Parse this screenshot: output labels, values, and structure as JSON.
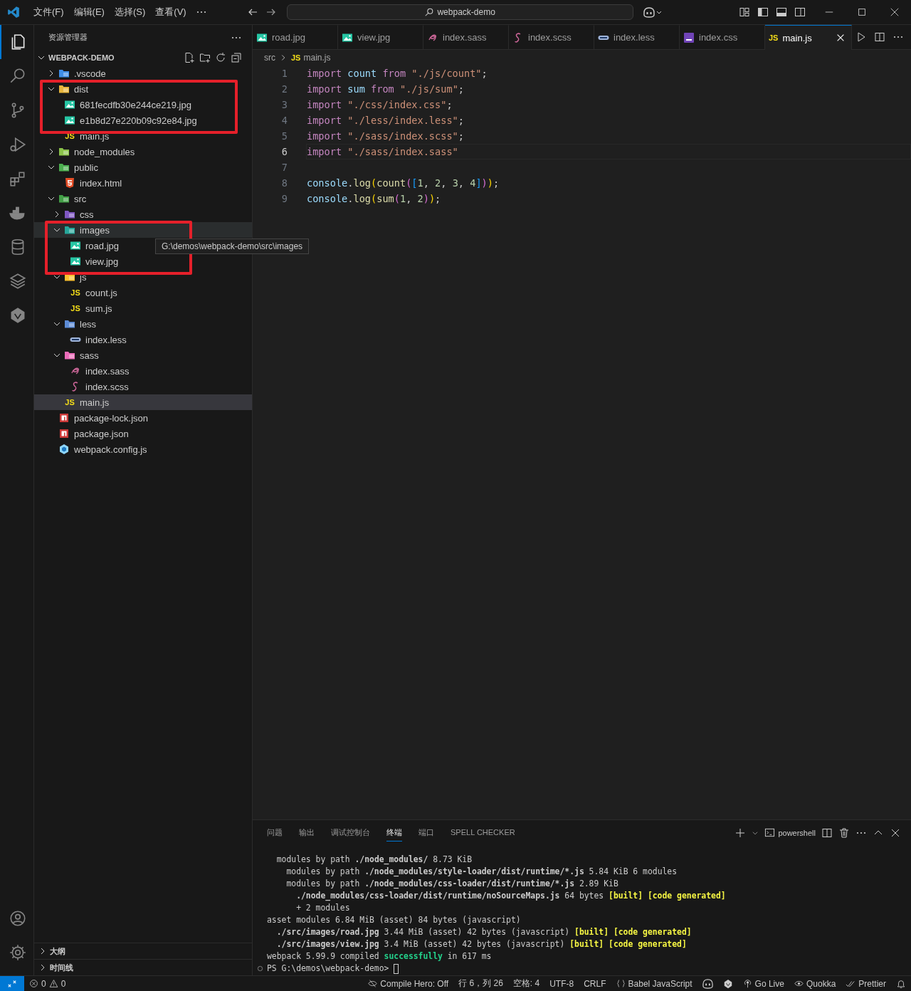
{
  "title_bar": {
    "menus": [
      "文件(F)",
      "编辑(E)",
      "选择(S)",
      "查看(V)"
    ],
    "search": {
      "value": "webpack-demo"
    }
  },
  "activity_bar": {
    "items": [
      {
        "kind": "explorer",
        "selected": true
      },
      {
        "kind": "search",
        "selected": false
      },
      {
        "kind": "source-control",
        "selected": false
      },
      {
        "kind": "run",
        "selected": false
      },
      {
        "kind": "extensions",
        "selected": false
      },
      {
        "kind": "docker",
        "selected": false
      },
      {
        "kind": "database",
        "selected": false
      },
      {
        "kind": "layers",
        "selected": false
      },
      {
        "kind": "plugin",
        "selected": false
      }
    ],
    "bottom": [
      {
        "kind": "account"
      },
      {
        "kind": "settings"
      }
    ]
  },
  "sidebar": {
    "title": "资源管理器",
    "project": "WEBPACK-DEMO",
    "tree": [
      {
        "label": ".vscode",
        "kind": "folder",
        "color": "#3f8ee8",
        "expanded": false,
        "selected": false,
        "annotated": false
      },
      {
        "label": "dist",
        "kind": "folder",
        "color": "#e8b53c",
        "expanded": true,
        "selected": false,
        "annotated": true,
        "children": [
          {
            "label": "681fecdfb30e244ce219.jpg",
            "kind": "image",
            "selected": false,
            "annotated": true
          },
          {
            "label": "e1b8d27e220b09c92e84.jpg",
            "kind": "image",
            "selected": false,
            "annotated": true
          },
          {
            "label": "main.js",
            "kind": "js",
            "icon_text": "JS",
            "selected": false,
            "annotated": false
          }
        ]
      },
      {
        "label": "node_modules",
        "kind": "folder",
        "color": "#8bc34a",
        "expanded": false,
        "selected": false,
        "annotated": false
      },
      {
        "label": "public",
        "kind": "folder",
        "color": "#4caf50",
        "expanded": true,
        "selected": false,
        "annotated": false,
        "children": [
          {
            "label": "index.html",
            "kind": "html",
            "selected": false,
            "annotated": false
          }
        ]
      },
      {
        "label": "src",
        "kind": "folder",
        "color": "#43a047",
        "expanded": true,
        "selected": false,
        "annotated": false,
        "children": [
          {
            "label": "css",
            "kind": "folder",
            "color": "#7e57c2",
            "expanded": false,
            "selected": false,
            "annotated": false
          },
          {
            "label": "images",
            "kind": "folder",
            "color": "#26a69a",
            "expanded": true,
            "selected": false,
            "annotated": true,
            "tooltip": "G:\\demos\\webpack-demo\\src\\images",
            "children": [
              {
                "label": "road.jpg",
                "kind": "image",
                "selected": false,
                "annotated": true
              },
              {
                "label": "view.jpg",
                "kind": "image",
                "selected": false,
                "annotated": true
              }
            ]
          },
          {
            "label": "js",
            "kind": "folder",
            "color": "#fbc02d",
            "expanded": true,
            "selected": false,
            "annotated": false,
            "children": [
              {
                "label": "count.js",
                "kind": "js",
                "icon_text": "JS",
                "selected": false,
                "annotated": false
              },
              {
                "label": "sum.js",
                "kind": "js",
                "icon_text": "JS",
                "selected": false,
                "annotated": false
              }
            ]
          },
          {
            "label": "less",
            "kind": "folder",
            "color": "#5c8bd6",
            "expanded": true,
            "selected": false,
            "annotated": false,
            "children": [
              {
                "label": "index.less",
                "kind": "less",
                "selected": false,
                "annotated": false
              }
            ]
          },
          {
            "label": "sass",
            "kind": "folder",
            "color": "#ec6cb9",
            "expanded": true,
            "selected": false,
            "annotated": false,
            "children": [
              {
                "label": "index.sass",
                "kind": "sass",
                "selected": false,
                "annotated": false
              },
              {
                "label": "index.scss",
                "kind": "scss",
                "selected": false,
                "annotated": false
              }
            ]
          },
          {
            "label": "main.js",
            "kind": "js",
            "icon_text": "JS",
            "selected": true,
            "annotated": false
          }
        ]
      },
      {
        "label": "package-lock.json",
        "kind": "npm",
        "selected": false,
        "annotated": false
      },
      {
        "label": "package.json",
        "kind": "npm",
        "selected": false,
        "annotated": false
      },
      {
        "label": "webpack.config.js",
        "kind": "webpack",
        "selected": false,
        "annotated": false
      }
    ],
    "sections": [
      {
        "label": "大纲",
        "expanded": false
      },
      {
        "label": "时间线",
        "expanded": false
      }
    ]
  },
  "tabs": [
    {
      "label": "road.jpg",
      "kind": "image",
      "selected": false
    },
    {
      "label": "view.jpg",
      "kind": "image",
      "selected": false
    },
    {
      "label": "index.sass",
      "kind": "sass",
      "selected": false
    },
    {
      "label": "index.scss",
      "kind": "scss",
      "selected": false
    },
    {
      "label": "index.less",
      "kind": "less",
      "selected": false
    },
    {
      "label": "index.css",
      "kind": "css",
      "selected": false
    },
    {
      "label": "main.js",
      "kind": "js",
      "icon_text": "JS",
      "selected": true
    }
  ],
  "breadcrumb": {
    "folder": "src",
    "icon_text": "JS",
    "file": "main.js"
  },
  "code": [
    {
      "number": "1",
      "current": false,
      "tokens": [
        {
          "kind": "kw",
          "text": "import "
        },
        {
          "kind": "var",
          "text": "count "
        },
        {
          "kind": "kw",
          "text": "from "
        },
        {
          "kind": "str",
          "text": "\"./js/count\""
        },
        {
          "kind": "punc",
          "text": ";"
        }
      ]
    },
    {
      "number": "2",
      "current": false,
      "tokens": [
        {
          "kind": "kw",
          "text": "import "
        },
        {
          "kind": "var",
          "text": "sum "
        },
        {
          "kind": "kw",
          "text": "from "
        },
        {
          "kind": "str",
          "text": "\"./js/sum\""
        },
        {
          "kind": "punc",
          "text": ";"
        }
      ]
    },
    {
      "number": "3",
      "current": false,
      "tokens": [
        {
          "kind": "kw",
          "text": "import "
        },
        {
          "kind": "str",
          "text": "\"./css/index.css\""
        },
        {
          "kind": "punc",
          "text": ";"
        }
      ]
    },
    {
      "number": "4",
      "current": false,
      "tokens": [
        {
          "kind": "kw",
          "text": "import "
        },
        {
          "kind": "str",
          "text": "\"./less/index.less\""
        },
        {
          "kind": "punc",
          "text": ";"
        }
      ]
    },
    {
      "number": "5",
      "current": false,
      "tokens": [
        {
          "kind": "kw",
          "text": "import "
        },
        {
          "kind": "str",
          "text": "\"./sass/index.scss\""
        },
        {
          "kind": "punc",
          "text": ";"
        }
      ]
    },
    {
      "number": "6",
      "current": true,
      "tokens": [
        {
          "kind": "kw",
          "text": "import "
        },
        {
          "kind": "str",
          "text": "\"./sass/index.sass\""
        }
      ]
    },
    {
      "number": "7",
      "current": false
    },
    {
      "number": "8",
      "current": false,
      "tokens": [
        {
          "kind": "var",
          "text": "console"
        },
        {
          "kind": "punc",
          "text": "."
        },
        {
          "kind": "fn",
          "text": "log"
        },
        {
          "kind": "b1",
          "text": "("
        },
        {
          "kind": "fn",
          "text": "count"
        },
        {
          "kind": "b2",
          "text": "("
        },
        {
          "kind": "b3",
          "text": "["
        },
        {
          "kind": "num",
          "text": "1"
        },
        {
          "kind": "punc",
          "text": ", "
        },
        {
          "kind": "num",
          "text": "2"
        },
        {
          "kind": "punc",
          "text": ", "
        },
        {
          "kind": "num",
          "text": "3"
        },
        {
          "kind": "punc",
          "text": ", "
        },
        {
          "kind": "num",
          "text": "4"
        },
        {
          "kind": "b3",
          "text": "]"
        },
        {
          "kind": "b2",
          "text": ")"
        },
        {
          "kind": "b1",
          "text": ")"
        },
        {
          "kind": "punc",
          "text": ";"
        }
      ]
    },
    {
      "number": "9",
      "current": false,
      "tokens": [
        {
          "kind": "var",
          "text": "console"
        },
        {
          "kind": "punc",
          "text": "."
        },
        {
          "kind": "fn",
          "text": "log"
        },
        {
          "kind": "b1",
          "text": "("
        },
        {
          "kind": "fn",
          "text": "sum"
        },
        {
          "kind": "b2",
          "text": "("
        },
        {
          "kind": "num",
          "text": "1"
        },
        {
          "kind": "punc",
          "text": ", "
        },
        {
          "kind": "num",
          "text": "2"
        },
        {
          "kind": "b2",
          "text": ")"
        },
        {
          "kind": "b1",
          "text": ")"
        },
        {
          "kind": "punc",
          "text": ";"
        }
      ]
    }
  ],
  "panel": {
    "tabs": [
      {
        "label": "问题",
        "selected": false
      },
      {
        "label": "输出",
        "selected": false
      },
      {
        "label": "调试控制台",
        "selected": false
      },
      {
        "label": "终端",
        "selected": true
      },
      {
        "label": "端口",
        "selected": false
      },
      {
        "label": "SPELL CHECKER",
        "selected": false
      }
    ],
    "shell": "powershell",
    "terminal": [
      {
        "segments": [
          {
            "kind": "plain",
            "text": "  modules by path "
          },
          {
            "kind": "bold",
            "text": "./node_modules/"
          },
          {
            "kind": "plain",
            "text": " 8.73 KiB"
          }
        ]
      },
      {
        "segments": [
          {
            "kind": "plain",
            "text": "    modules by path "
          },
          {
            "kind": "bold",
            "text": "./node_modules/style-loader/dist/runtime/*.js"
          },
          {
            "kind": "plain",
            "text": " 5.84 KiB 6 modules"
          }
        ]
      },
      {
        "segments": [
          {
            "kind": "plain",
            "text": "    modules by path "
          },
          {
            "kind": "bold",
            "text": "./node_modules/css-loader/dist/runtime/*.js"
          },
          {
            "kind": "plain",
            "text": " 2.89 KiB"
          }
        ]
      },
      {
        "segments": [
          {
            "kind": "bold",
            "text": "      ./node_modules/css-loader/dist/runtime/noSourceMaps.js"
          },
          {
            "kind": "plain",
            "text": " 64 bytes "
          },
          {
            "kind": "yellow",
            "text": "[built] [code generated]"
          }
        ]
      },
      {
        "segments": [
          {
            "kind": "plain",
            "text": "      + 2 modules"
          }
        ]
      },
      {
        "segments": [
          {
            "kind": "plain",
            "text": "asset modules 6.84 MiB (asset) 84 bytes (javascript)"
          }
        ]
      },
      {
        "segments": [
          {
            "kind": "bold",
            "text": "  ./src/images/road.jpg"
          },
          {
            "kind": "plain",
            "text": " 3.44 MiB (asset) 42 bytes (javascript) "
          },
          {
            "kind": "yellow",
            "text": "[built] [code generated]"
          }
        ]
      },
      {
        "segments": [
          {
            "kind": "bold",
            "text": "  ./src/images/view.jpg"
          },
          {
            "kind": "plain",
            "text": " 3.4 MiB (asset) 42 bytes (javascript) "
          },
          {
            "kind": "yellow",
            "text": "[built] [code generated]"
          }
        ]
      },
      {
        "segments": [
          {
            "kind": "plain",
            "text": "webpack 5.99.9 compiled "
          },
          {
            "kind": "green",
            "text": "successfully"
          },
          {
            "kind": "plain",
            "text": " in 617 ms"
          }
        ]
      }
    ],
    "prompt": "PS G:\\demos\\webpack-demo> "
  },
  "status_bar": {
    "errors": "0",
    "warnings": "0",
    "items": [
      {
        "kind": "compile",
        "text": "Compile Hero: Off"
      },
      {
        "kind": "text",
        "text": "行 6，列 26"
      },
      {
        "kind": "text",
        "text": "空格: 4"
      },
      {
        "kind": "text",
        "text": "UTF-8"
      },
      {
        "kind": "text",
        "text": "CRLF"
      },
      {
        "kind": "language",
        "text": "Babel JavaScript"
      },
      {
        "kind": "copilot"
      },
      {
        "kind": "plugin"
      },
      {
        "kind": "live",
        "text": "Go Live"
      },
      {
        "kind": "quokka",
        "text": "Quokka"
      },
      {
        "kind": "prettier",
        "text": "Prettier"
      },
      {
        "kind": "bell"
      }
    ]
  }
}
